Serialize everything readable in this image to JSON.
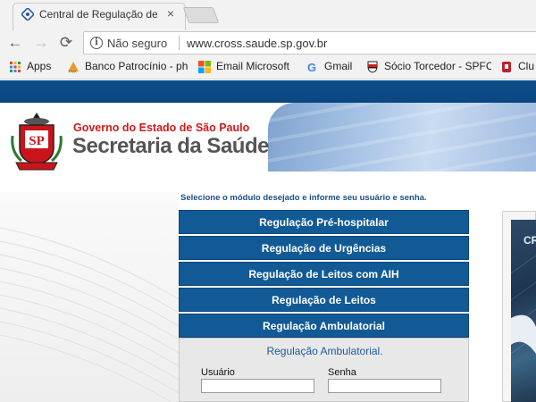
{
  "browser": {
    "tab": {
      "title": "Central de Regulação de",
      "close_glyph": "×"
    },
    "toolbar": {
      "back_glyph": "←",
      "forward_glyph": "→",
      "reload_glyph": "⟳",
      "security_label": "Não seguro",
      "url": "www.cross.saude.sp.gov.br",
      "info_glyph": "i"
    },
    "bookmarks": [
      {
        "label": "Apps",
        "icon": "apps-grid-icon"
      },
      {
        "label": "Banco Patrocínio - ph",
        "icon": "bank-icon"
      },
      {
        "label": "Email Microsoft",
        "icon": "microsoft-icon"
      },
      {
        "label": "Gmail",
        "icon": "google-icon"
      },
      {
        "label": "Sócio Torcedor - SPFC",
        "icon": "spfc-icon"
      },
      {
        "label": "Clu",
        "icon": "club-icon"
      }
    ]
  },
  "header": {
    "seal_text": "SP",
    "government": "Governo do Estado de São Paulo",
    "secretariat": "Secretaria da Saúde"
  },
  "main": {
    "instruction": "Selecione o módulo desejado e informe seu usuário e senha.",
    "modules": [
      "Regulação Pré-hospitalar",
      "Regulação de Urgências",
      "Regulação de Leitos com AIH",
      "Regulação de Leitos",
      "Regulação Ambulatorial"
    ],
    "login": {
      "title": "Regulação Ambulatorial.",
      "user_label": "Usuário",
      "password_label": "Senha",
      "user_value": "",
      "password_value": ""
    },
    "right_panel_text": "CR"
  },
  "colors": {
    "brand_blue": "#125a96",
    "band_blue": "#0d4e8c",
    "gov_red": "#d11a1a",
    "title_gray": "#555555"
  }
}
